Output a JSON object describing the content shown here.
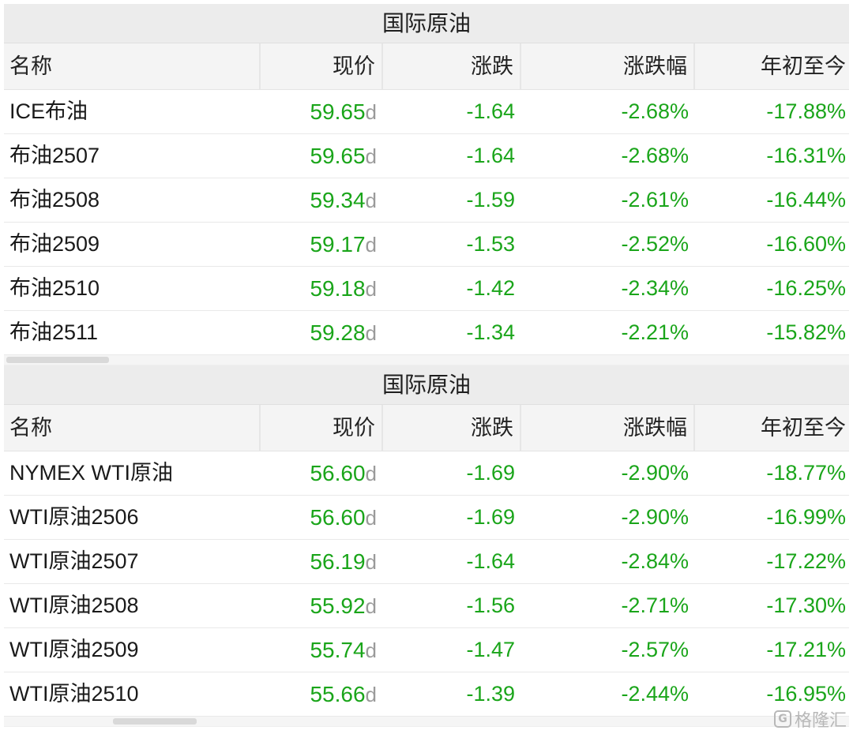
{
  "brent": {
    "title": "国际原油",
    "headers": {
      "name": "名称",
      "price": "现价",
      "change": "涨跌",
      "change_pct": "涨跌幅",
      "ytd": "年初至今"
    },
    "rows": [
      {
        "name": "ICE布油",
        "price": "59.65",
        "suffix": "d",
        "change": "-1.64",
        "change_pct": "-2.68%",
        "ytd": "-17.88%"
      },
      {
        "name": "布油2507",
        "price": "59.65",
        "suffix": "d",
        "change": "-1.64",
        "change_pct": "-2.68%",
        "ytd": "-16.31%"
      },
      {
        "name": "布油2508",
        "price": "59.34",
        "suffix": "d",
        "change": "-1.59",
        "change_pct": "-2.61%",
        "ytd": "-16.44%"
      },
      {
        "name": "布油2509",
        "price": "59.17",
        "suffix": "d",
        "change": "-1.53",
        "change_pct": "-2.52%",
        "ytd": "-16.60%"
      },
      {
        "name": "布油2510",
        "price": "59.18",
        "suffix": "d",
        "change": "-1.42",
        "change_pct": "-2.34%",
        "ytd": "-16.25%"
      },
      {
        "name": "布油2511",
        "price": "59.28",
        "suffix": "d",
        "change": "-1.34",
        "change_pct": "-2.21%",
        "ytd": "-15.82%"
      }
    ]
  },
  "wti": {
    "title": "国际原油",
    "headers": {
      "name": "名称",
      "price": "现价",
      "change": "涨跌",
      "change_pct": "涨跌幅",
      "ytd": "年初至今"
    },
    "rows": [
      {
        "name": "NYMEX WTI原油",
        "price": "56.60",
        "suffix": "d",
        "change": "-1.69",
        "change_pct": "-2.90%",
        "ytd": "-18.77%"
      },
      {
        "name": "WTI原油2506",
        "price": "56.60",
        "suffix": "d",
        "change": "-1.69",
        "change_pct": "-2.90%",
        "ytd": "-16.99%"
      },
      {
        "name": "WTI原油2507",
        "price": "56.19",
        "suffix": "d",
        "change": "-1.64",
        "change_pct": "-2.84%",
        "ytd": "-17.22%"
      },
      {
        "name": "WTI原油2508",
        "price": "55.92",
        "suffix": "d",
        "change": "-1.56",
        "change_pct": "-2.71%",
        "ytd": "-17.30%"
      },
      {
        "name": "WTI原油2509",
        "price": "55.74",
        "suffix": "d",
        "change": "-1.47",
        "change_pct": "-2.57%",
        "ytd": "-17.21%"
      },
      {
        "name": "WTI原油2510",
        "price": "55.66",
        "suffix": "d",
        "change": "-1.39",
        "change_pct": "-2.44%",
        "ytd": "-16.95%"
      }
    ]
  },
  "watermark": {
    "logo_glyph": "G",
    "text": "格隆汇"
  },
  "colors": {
    "negative": "#1aa51a",
    "suffix": "#9a9a9a",
    "header_bg": "#f4f4f4",
    "title_bg": "#ececec"
  }
}
